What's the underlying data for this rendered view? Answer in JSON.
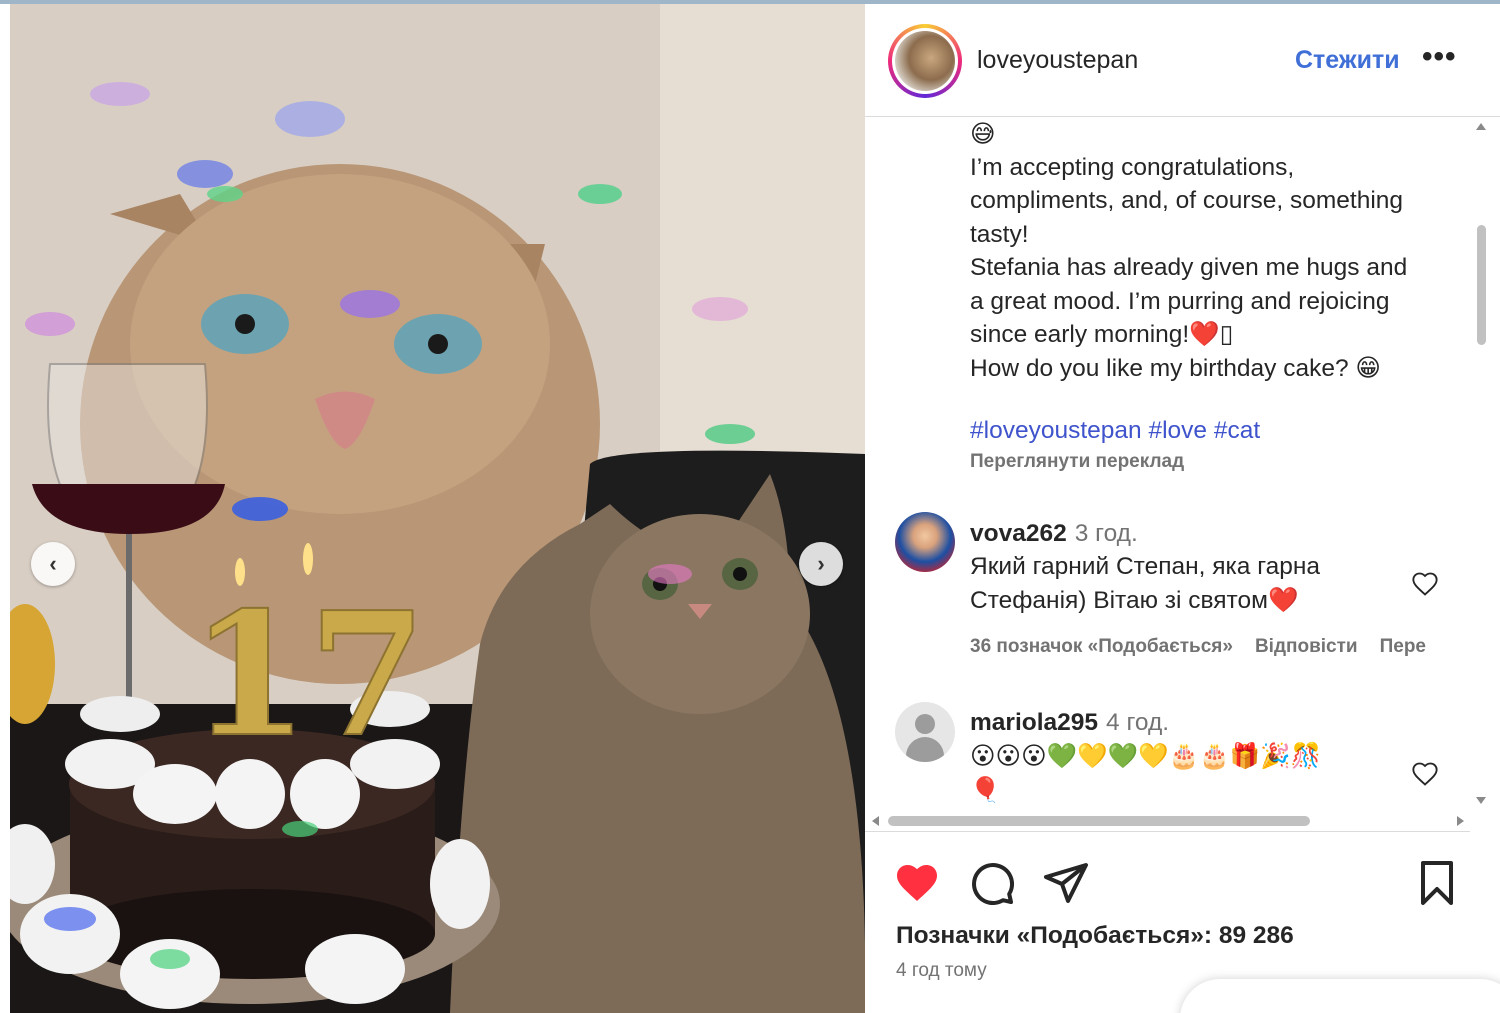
{
  "post": {
    "username": "loveyoustepan",
    "follow_label": "Стежити",
    "more_label": "•••"
  },
  "caption": {
    "lines": [
      "😅",
      "I’m accepting congratulations,",
      "compliments, and, of course, something",
      "tasty!",
      "Stefania has already given me hugs and",
      "a great mood. I’m purring and rejoicing",
      "since early morning!❤️▯",
      "How do you like my birthday cake? 😁"
    ],
    "hashtags": "#loveyoustepan #love #cat",
    "translate_label": "Переглянути переклад"
  },
  "comments": [
    {
      "user": "vova262",
      "time": "3 год.",
      "text_lines": [
        "Який гарний Степан, яка гарна",
        "Стефанія) Вітаю зі святом❤️"
      ],
      "likes_label": "36 позначок «Подобається»",
      "reply_label": "Відповісти",
      "translate_label": "Пере"
    },
    {
      "user": "mariola295",
      "time": "4 год.",
      "text_lines": [
        "😮😮😮💚💛💚💛🎂🎂🎁🎉🎊",
        "🎈"
      ]
    }
  ],
  "footer": {
    "likes_text": "Позначки «Подобається»: 89 286",
    "posted_ago": "4 год тому"
  },
  "photo": {
    "candle_number": "17",
    "prev_label": "‹",
    "next_label": "›"
  },
  "colors": {
    "accent_blue": "#3f6fd7",
    "hashtag": "#3e53cc",
    "like_red": "#ff3040",
    "muted": "#737373"
  },
  "icons": [
    "heart-icon",
    "comment-icon",
    "share-icon",
    "bookmark-icon",
    "more-icon",
    "chevron-left-icon",
    "chevron-right-icon"
  ]
}
